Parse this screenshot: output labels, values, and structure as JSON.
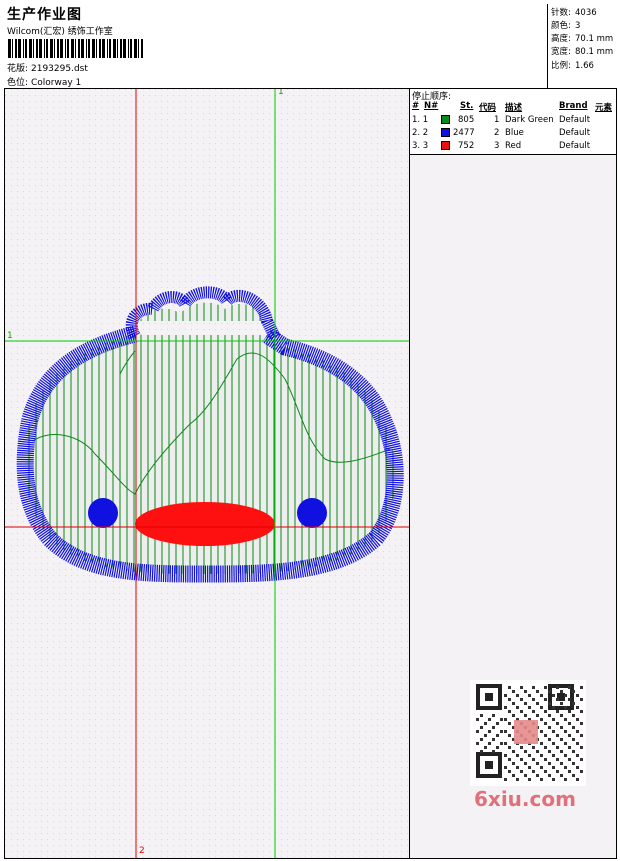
{
  "header": {
    "title": "生产作业图",
    "company": "Wilcom(汇宏) 绣饰工作室",
    "design_file_label": "花版:",
    "design_file": "2193295.dst",
    "colorway_label": "色位:",
    "colorway": "Colorway 1"
  },
  "stats": [
    {
      "label": "针数:",
      "value": "4036"
    },
    {
      "label": "颜色:",
      "value": "3"
    },
    {
      "label": "高度:",
      "value": "70.1 mm"
    },
    {
      "label": "宽度:",
      "value": "80.1 mm"
    },
    {
      "label": "比例:",
      "value": "1.66"
    }
  ],
  "stop_sequence": {
    "title": "停止顺序:",
    "columns": [
      "#",
      "N#",
      "St.",
      "代码",
      "描述",
      "Brand",
      "元素"
    ],
    "rows": [
      {
        "idx": "1. 1",
        "stitches": "805",
        "code": "1",
        "desc": "Dark Green",
        "brand": "Default",
        "color": "#0a8a1a"
      },
      {
        "idx": "2. 2",
        "stitches": "2477",
        "code": "2",
        "desc": "Blue",
        "brand": "Default",
        "color": "#1010e0"
      },
      {
        "idx": "3. 3",
        "stitches": "752",
        "code": "3",
        "desc": "Red",
        "brand": "Default",
        "color": "#ee1010"
      }
    ]
  },
  "axes": {
    "h_top": "1",
    "v_top": "1",
    "v_bottom": "2"
  },
  "watermark": {
    "text": "6xiu.com"
  },
  "colors": {
    "red_line": "#e00000",
    "green_line": "#00cc00",
    "blue": "#1010e0",
    "fill_green": "#0a8a1a",
    "red": "#ff1010"
  }
}
